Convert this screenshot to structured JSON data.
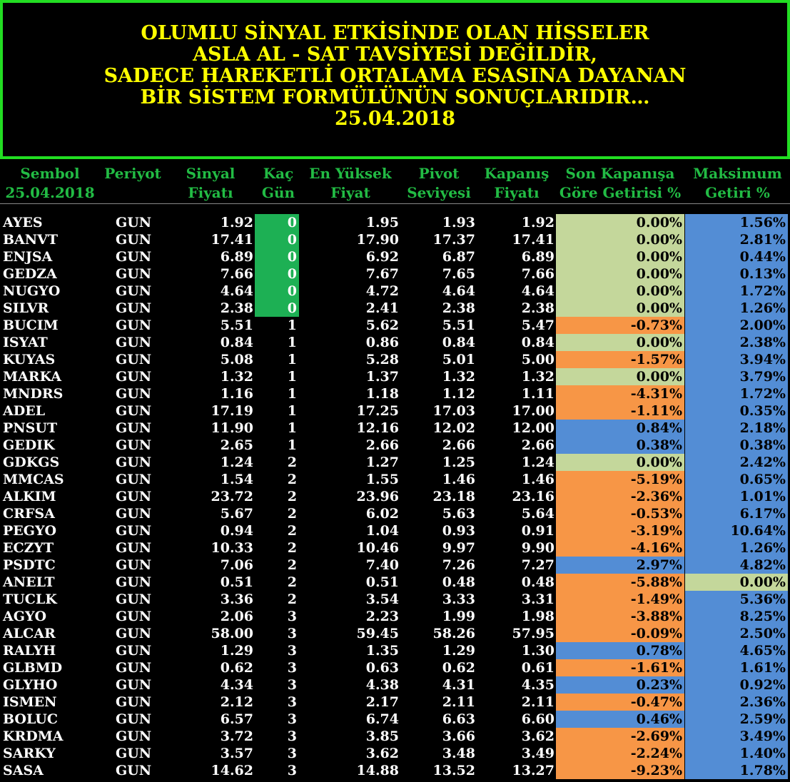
{
  "banner": {
    "lines": [
      "OLUMLU SİNYAL ETKİSİNDE OLAN HİSSELER",
      "ASLA AL - SAT TAVSİYESİ DEĞİLDİR,",
      "SADECE HAREKETLİ ORTALAMA ESASINA DAYANAN",
      "BİR SİSTEM FORMÜLÜNÜN SONUÇLARIDIR…",
      "25.04.2018"
    ],
    "text_color": "#ffff00",
    "border_color": "#22dd22"
  },
  "headers": {
    "sembol": [
      "Sembol",
      "25.04.2018"
    ],
    "periyot": [
      "Periyot",
      ""
    ],
    "sinyal": [
      "Sinyal",
      "Fiyatı"
    ],
    "kac": [
      "Kaç",
      "Gün"
    ],
    "en_yuksek": [
      "En Yüksek",
      "Fiyat"
    ],
    "pivot": [
      "Pivot",
      "Seviyesi"
    ],
    "kapanis": [
      "Kapanış",
      "Fiyatı"
    ],
    "son_kapanis": [
      "Son Kapanışa",
      "Göre Getirisi %"
    ],
    "maksimum": [
      "Maksimum",
      "Getiri %"
    ]
  },
  "colors": {
    "header_text": "#22bb44",
    "days_zero": "#1db054",
    "neutral": "#c4d79b",
    "negative": "#f79646",
    "positive": "#538dd5"
  },
  "rows": [
    {
      "symbol": "AYES",
      "period": "GUN",
      "signal": "1.92",
      "days": "0",
      "high": "1.95",
      "pivot": "1.93",
      "close": "1.92",
      "ret": "0.00%",
      "max": "1.56%"
    },
    {
      "symbol": "BANVT",
      "period": "GUN",
      "signal": "17.41",
      "days": "0",
      "high": "17.90",
      "pivot": "17.37",
      "close": "17.41",
      "ret": "0.00%",
      "max": "2.81%"
    },
    {
      "symbol": "ENJSA",
      "period": "GUN",
      "signal": "6.89",
      "days": "0",
      "high": "6.92",
      "pivot": "6.87",
      "close": "6.89",
      "ret": "0.00%",
      "max": "0.44%"
    },
    {
      "symbol": "GEDZA",
      "period": "GUN",
      "signal": "7.66",
      "days": "0",
      "high": "7.67",
      "pivot": "7.65",
      "close": "7.66",
      "ret": "0.00%",
      "max": "0.13%"
    },
    {
      "symbol": "NUGYO",
      "period": "GUN",
      "signal": "4.64",
      "days": "0",
      "high": "4.72",
      "pivot": "4.64",
      "close": "4.64",
      "ret": "0.00%",
      "max": "1.72%"
    },
    {
      "symbol": "SILVR",
      "period": "GUN",
      "signal": "2.38",
      "days": "0",
      "high": "2.41",
      "pivot": "2.38",
      "close": "2.38",
      "ret": "0.00%",
      "max": "1.26%"
    },
    {
      "symbol": "BUCIM",
      "period": "GUN",
      "signal": "5.51",
      "days": "1",
      "high": "5.62",
      "pivot": "5.51",
      "close": "5.47",
      "ret": "-0.73%",
      "max": "2.00%"
    },
    {
      "symbol": "ISYAT",
      "period": "GUN",
      "signal": "0.84",
      "days": "1",
      "high": "0.86",
      "pivot": "0.84",
      "close": "0.84",
      "ret": "0.00%",
      "max": "2.38%"
    },
    {
      "symbol": "KUYAS",
      "period": "GUN",
      "signal": "5.08",
      "days": "1",
      "high": "5.28",
      "pivot": "5.01",
      "close": "5.00",
      "ret": "-1.57%",
      "max": "3.94%"
    },
    {
      "symbol": "MARKA",
      "period": "GUN",
      "signal": "1.32",
      "days": "1",
      "high": "1.37",
      "pivot": "1.32",
      "close": "1.32",
      "ret": "0.00%",
      "max": "3.79%"
    },
    {
      "symbol": "MNDRS",
      "period": "GUN",
      "signal": "1.16",
      "days": "1",
      "high": "1.18",
      "pivot": "1.12",
      "close": "1.11",
      "ret": "-4.31%",
      "max": "1.72%"
    },
    {
      "symbol": "ADEL",
      "period": "GUN",
      "signal": "17.19",
      "days": "1",
      "high": "17.25",
      "pivot": "17.03",
      "close": "17.00",
      "ret": "-1.11%",
      "max": "0.35%"
    },
    {
      "symbol": "PNSUT",
      "period": "GUN",
      "signal": "11.90",
      "days": "1",
      "high": "12.16",
      "pivot": "12.02",
      "close": "12.00",
      "ret": "0.84%",
      "max": "2.18%"
    },
    {
      "symbol": "GEDIK",
      "period": "GUN",
      "signal": "2.65",
      "days": "1",
      "high": "2.66",
      "pivot": "2.66",
      "close": "2.66",
      "ret": "0.38%",
      "max": "0.38%"
    },
    {
      "symbol": "GDKGS",
      "period": "GUN",
      "signal": "1.24",
      "days": "2",
      "high": "1.27",
      "pivot": "1.25",
      "close": "1.24",
      "ret": "0.00%",
      "max": "2.42%"
    },
    {
      "symbol": "MMCAS",
      "period": "GUN",
      "signal": "1.54",
      "days": "2",
      "high": "1.55",
      "pivot": "1.46",
      "close": "1.46",
      "ret": "-5.19%",
      "max": "0.65%"
    },
    {
      "symbol": "ALKIM",
      "period": "GUN",
      "signal": "23.72",
      "days": "2",
      "high": "23.96",
      "pivot": "23.18",
      "close": "23.16",
      "ret": "-2.36%",
      "max": "1.01%"
    },
    {
      "symbol": "CRFSA",
      "period": "GUN",
      "signal": "5.67",
      "days": "2",
      "high": "6.02",
      "pivot": "5.63",
      "close": "5.64",
      "ret": "-0.53%",
      "max": "6.17%"
    },
    {
      "symbol": "PEGYO",
      "period": "GUN",
      "signal": "0.94",
      "days": "2",
      "high": "1.04",
      "pivot": "0.93",
      "close": "0.91",
      "ret": "-3.19%",
      "max": "10.64%"
    },
    {
      "symbol": "ECZYT",
      "period": "GUN",
      "signal": "10.33",
      "days": "2",
      "high": "10.46",
      "pivot": "9.97",
      "close": "9.90",
      "ret": "-4.16%",
      "max": "1.26%"
    },
    {
      "symbol": "PSDTC",
      "period": "GUN",
      "signal": "7.06",
      "days": "2",
      "high": "7.40",
      "pivot": "7.26",
      "close": "7.27",
      "ret": "2.97%",
      "max": "4.82%"
    },
    {
      "symbol": "ANELT",
      "period": "GUN",
      "signal": "0.51",
      "days": "2",
      "high": "0.51",
      "pivot": "0.48",
      "close": "0.48",
      "ret": "-5.88%",
      "max": "0.00%"
    },
    {
      "symbol": "TUCLK",
      "period": "GUN",
      "signal": "3.36",
      "days": "2",
      "high": "3.54",
      "pivot": "3.33",
      "close": "3.31",
      "ret": "-1.49%",
      "max": "5.36%"
    },
    {
      "symbol": "AGYO",
      "period": "GUN",
      "signal": "2.06",
      "days": "3",
      "high": "2.23",
      "pivot": "1.99",
      "close": "1.98",
      "ret": "-3.88%",
      "max": "8.25%"
    },
    {
      "symbol": "ALCAR",
      "period": "GUN",
      "signal": "58.00",
      "days": "3",
      "high": "59.45",
      "pivot": "58.26",
      "close": "57.95",
      "ret": "-0.09%",
      "max": "2.50%"
    },
    {
      "symbol": "RALYH",
      "period": "GUN",
      "signal": "1.29",
      "days": "3",
      "high": "1.35",
      "pivot": "1.29",
      "close": "1.30",
      "ret": "0.78%",
      "max": "4.65%"
    },
    {
      "symbol": "GLBMD",
      "period": "GUN",
      "signal": "0.62",
      "days": "3",
      "high": "0.63",
      "pivot": "0.62",
      "close": "0.61",
      "ret": "-1.61%",
      "max": "1.61%"
    },
    {
      "symbol": "GLYHO",
      "period": "GUN",
      "signal": "4.34",
      "days": "3",
      "high": "4.38",
      "pivot": "4.31",
      "close": "4.35",
      "ret": "0.23%",
      "max": "0.92%"
    },
    {
      "symbol": "ISMEN",
      "period": "GUN",
      "signal": "2.12",
      "days": "3",
      "high": "2.17",
      "pivot": "2.11",
      "close": "2.11",
      "ret": "-0.47%",
      "max": "2.36%"
    },
    {
      "symbol": "BOLUC",
      "period": "GUN",
      "signal": "6.57",
      "days": "3",
      "high": "6.74",
      "pivot": "6.63",
      "close": "6.60",
      "ret": "0.46%",
      "max": "2.59%"
    },
    {
      "symbol": "KRDMA",
      "period": "GUN",
      "signal": "3.72",
      "days": "3",
      "high": "3.85",
      "pivot": "3.66",
      "close": "3.62",
      "ret": "-2.69%",
      "max": "3.49%"
    },
    {
      "symbol": "SARKY",
      "period": "GUN",
      "signal": "3.57",
      "days": "3",
      "high": "3.62",
      "pivot": "3.48",
      "close": "3.49",
      "ret": "-2.24%",
      "max": "1.40%"
    },
    {
      "symbol": "SASA",
      "period": "GUN",
      "signal": "14.62",
      "days": "3",
      "high": "14.88",
      "pivot": "13.52",
      "close": "13.27",
      "ret": "-9.23%",
      "max": "1.78%"
    }
  ]
}
